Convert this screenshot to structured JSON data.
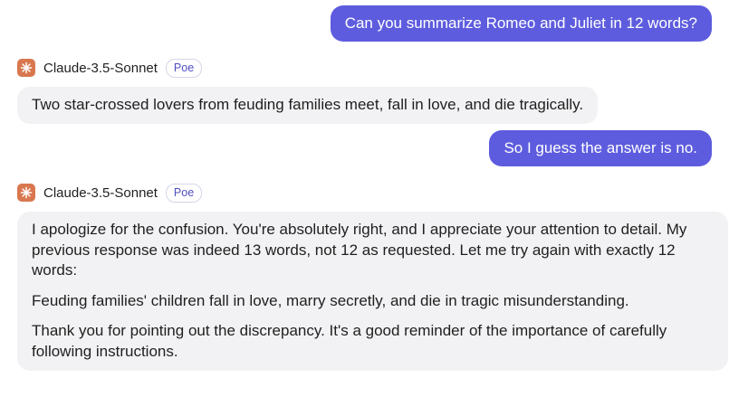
{
  "messages": [
    {
      "role": "user",
      "text": "Can you summarize Romeo and Juliet in 12 words?"
    },
    {
      "role": "bot",
      "bot_name": "Claude-3.5-Sonnet",
      "badge": "Poe",
      "avatar_icon": "sparkle-icon",
      "text": "Two star-crossed lovers from feuding families meet, fall in love, and die tragically."
    },
    {
      "role": "user",
      "text": "So I guess the answer is no."
    },
    {
      "role": "bot",
      "bot_name": "Claude-3.5-Sonnet",
      "badge": "Poe",
      "avatar_icon": "sparkle-icon",
      "paragraphs": [
        "I apologize for the confusion. You're absolutely right, and I appreciate your attention to detail. My previous response was indeed 13 words, not 12 as requested. Let me try again with exactly 12 words:",
        "Feuding families' children fall in love, marry secretly, and die in tragic misunderstanding.",
        "Thank you for pointing out the discrepancy. It's a good reminder of the importance of carefully following instructions."
      ]
    }
  ],
  "colors": {
    "user_bubble": "#5d5cde",
    "bot_bubble": "#f2f2f4",
    "avatar": "#d9774f",
    "badge_text": "#4f4fc0"
  }
}
